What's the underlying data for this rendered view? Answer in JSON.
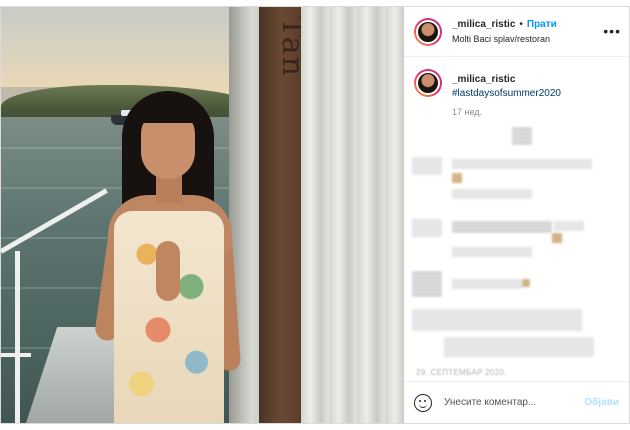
{
  "header": {
    "username": "_milica_ristic",
    "separator": "•",
    "follow_label": "Прати",
    "location": "Molti Baci splav/restoran"
  },
  "caption": {
    "username": "_milica_ristic",
    "hashtag": "#lastdaysofsummer2020",
    "time": "17 нед."
  },
  "photo": {
    "pillar_text": "Tan"
  },
  "comments_date": "29. СЕПТЕМБАР 2020.",
  "add_comment": {
    "placeholder": "Унесите коментар...",
    "post_label": "Објави"
  },
  "icons": {
    "more": "more-options-icon",
    "emoji": "emoji-icon"
  },
  "colors": {
    "follow": "#0095f6",
    "hashtag": "#00376b",
    "post_disabled": "#b2dffc"
  }
}
